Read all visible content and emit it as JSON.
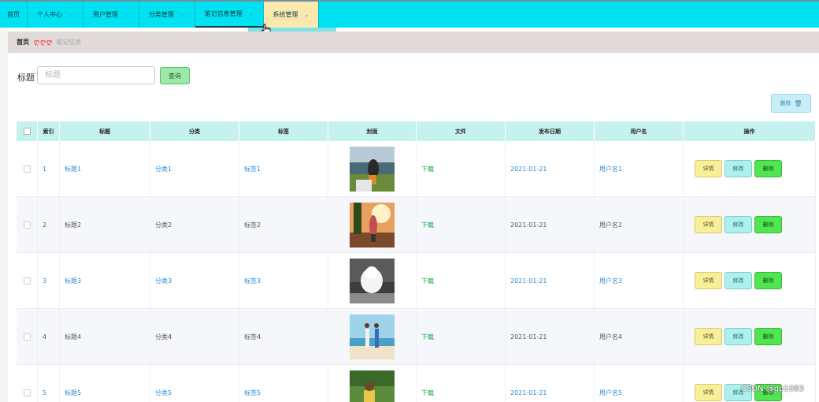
{
  "nav": {
    "items": [
      {
        "label": "首页",
        "has_chevron": false
      },
      {
        "label": "个人中心",
        "has_chevron": true
      },
      {
        "label": "用户管理",
        "has_chevron": true
      },
      {
        "label": "分类管理",
        "has_chevron": true
      },
      {
        "label": "笔记信息管理",
        "has_chevron": true
      },
      {
        "label": "系统管理",
        "has_chevron": true
      }
    ]
  },
  "breadcrumb": {
    "home": "首页",
    "current": "笔记信息"
  },
  "search": {
    "label": "标题",
    "placeholder": "标题",
    "value": "",
    "button": "查询"
  },
  "toolbar": {
    "delete_label": "删除"
  },
  "table": {
    "headers": [
      "索引",
      "标题",
      "分类",
      "标签",
      "封面",
      "文件",
      "发布日期",
      "用户名",
      "操作"
    ],
    "rows": [
      {
        "index": "1",
        "title": "标题1",
        "category": "分类1",
        "tag": "标签1",
        "file": "下载",
        "date": "2021-01-21",
        "user": "用户名1"
      },
      {
        "index": "2",
        "title": "标题2",
        "category": "分类2",
        "tag": "标签2",
        "file": "下载",
        "date": "2021-01-21",
        "user": "用户名2"
      },
      {
        "index": "3",
        "title": "标题3",
        "category": "分类3",
        "tag": "标签3",
        "file": "下载",
        "date": "2021-01-21",
        "user": "用户名3"
      },
      {
        "index": "4",
        "title": "标题4",
        "category": "分类4",
        "tag": "标签4",
        "file": "下载",
        "date": "2021-01-21",
        "user": "用户名4"
      },
      {
        "index": "5",
        "title": "标题5",
        "category": "分类5",
        "tag": "标签5",
        "file": "下载",
        "date": "2021-01-21",
        "user": "用户名5"
      }
    ],
    "actions": {
      "detail": "详情",
      "edit": "修改",
      "delete": "删除"
    }
  },
  "watermark": "CSDN @gp1083",
  "colors": {
    "nav_bg": "#00e1f2",
    "nav_hover": "#fbe8ae",
    "header_bg": "#c5f1ef",
    "link": "#2b8bd6",
    "download": "#12a34a"
  }
}
